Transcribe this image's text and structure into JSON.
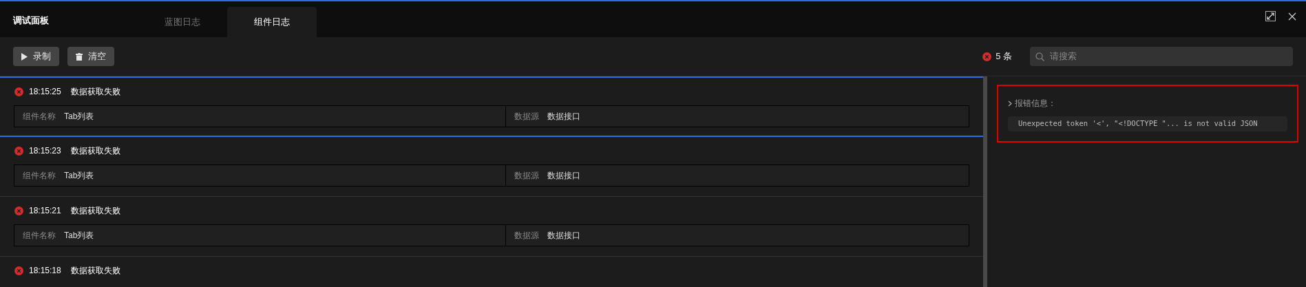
{
  "window": {
    "title": "调试面板"
  },
  "tabs": [
    {
      "label": "蓝图日志",
      "selected": false
    },
    {
      "label": "组件日志",
      "selected": true
    }
  ],
  "toolbar": {
    "buttons": [
      {
        "kind": "play",
        "label": "录制"
      },
      {
        "kind": "trash",
        "label": "清空"
      }
    ],
    "error_count": "5 条",
    "search": {
      "placeholder": "请搜索"
    }
  },
  "logs": [
    {
      "time": "18:15:25",
      "message": "数据获取失败",
      "selected": true,
      "fields": [
        {
          "label": "组件名称",
          "value": "Tab列表"
        },
        {
          "label": "数据源",
          "value": "数据接口"
        }
      ]
    },
    {
      "time": "18:15:23",
      "message": "数据获取失败",
      "selected": false,
      "fields": [
        {
          "label": "组件名称",
          "value": "Tab列表"
        },
        {
          "label": "数据源",
          "value": "数据接口"
        }
      ]
    },
    {
      "time": "18:15:21",
      "message": "数据获取失败",
      "selected": false,
      "fields": [
        {
          "label": "组件名称",
          "value": "Tab列表"
        },
        {
          "label": "数据源",
          "value": "数据接口"
        }
      ]
    },
    {
      "time": "18:15:18",
      "message": "数据获取失败",
      "selected": false
    }
  ],
  "detail": {
    "highlighted": true,
    "heading": "报错信息：",
    "error": "Unexpected token '<', \"<!DOCTYPE \"... is not valid JSON"
  }
}
